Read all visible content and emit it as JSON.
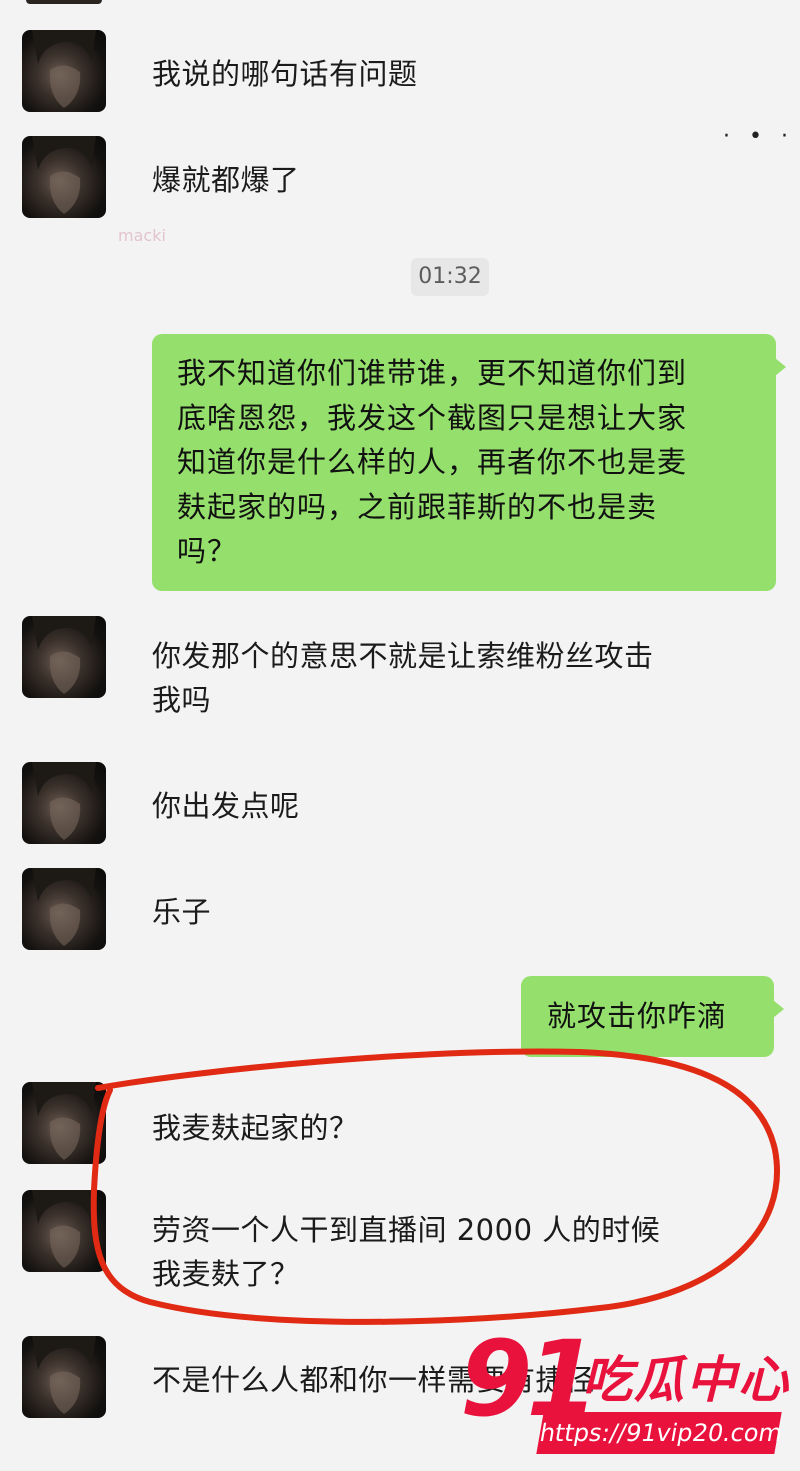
{
  "messages": [
    {
      "side": "left",
      "text": "我说的哪句话有问题"
    },
    {
      "side": "left",
      "text": "爆就都爆了"
    },
    {
      "type": "time",
      "text": "01:32"
    },
    {
      "side": "right",
      "lines": [
        "我不知道你们谁带谁，更不知道你们到",
        "底啥恩怨，我发这个截图只是想让大家",
        "知道你是什么样的人，再者你不也是麦",
        "麸起家的吗，之前跟菲斯的不也是卖",
        "吗？"
      ]
    },
    {
      "side": "left",
      "lines": [
        "你发那个的意思不就是让索维粉丝攻击",
        "我吗"
      ]
    },
    {
      "side": "left",
      "text": "你出发点呢"
    },
    {
      "side": "left",
      "text": "乐子"
    },
    {
      "side": "right",
      "text": "就攻击你咋滴"
    },
    {
      "side": "left",
      "text": "我麦麸起家的？"
    },
    {
      "side": "left",
      "lines": [
        "劳资一个人干到直播间 2000 人的时候",
        "我麦麸了？"
      ]
    },
    {
      "side": "left",
      "text": "不是什么人都和你一样需要有捷径"
    }
  ],
  "watermark": {
    "number": "91",
    "name": "吃瓜中心",
    "url": "https://91vip20.com"
  },
  "colors": {
    "bubble_right": "#95e06c",
    "annotation_red": "#e02a14",
    "watermark_red": "#e8123c"
  }
}
